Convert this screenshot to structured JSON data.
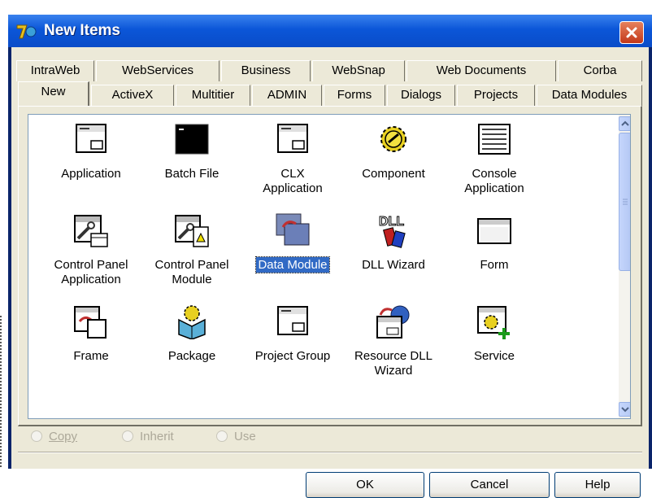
{
  "window": {
    "title": "New Items"
  },
  "tabs_row1": [
    "IntraWeb",
    "WebServices",
    "Business",
    "WebSnap",
    "Web Documents",
    "Corba"
  ],
  "tabs_row2": [
    "New",
    "ActiveX",
    "Multitier",
    "ADMIN",
    "Forms",
    "Dialogs",
    "Projects",
    "Data Modules"
  ],
  "selected_tab": "New",
  "items": [
    {
      "line1": "Application",
      "line2": "",
      "icon": "application-window-icon"
    },
    {
      "line1": "Batch File",
      "line2": "",
      "icon": "batch-file-icon"
    },
    {
      "line1": "CLX",
      "line2": "Application",
      "icon": "clx-application-icon"
    },
    {
      "line1": "Component",
      "line2": "",
      "icon": "component-gear-icon"
    },
    {
      "line1": "Console",
      "line2": "Application",
      "icon": "console-application-icon"
    },
    {
      "line1": "Control Panel",
      "line2": "Application",
      "icon": "control-panel-application-icon"
    },
    {
      "line1": "Control Panel",
      "line2": "Module",
      "icon": "control-panel-module-icon"
    },
    {
      "line1": "Data Module",
      "line2": "",
      "icon": "data-module-icon"
    },
    {
      "line1": "DLL Wizard",
      "line2": "",
      "icon": "dll-wizard-icon"
    },
    {
      "line1": "Form",
      "line2": "",
      "icon": "form-icon"
    },
    {
      "line1": "Frame",
      "line2": "",
      "icon": "frame-icon"
    },
    {
      "line1": "Package",
      "line2": "",
      "icon": "package-icon"
    },
    {
      "line1": "Project Group",
      "line2": "",
      "icon": "project-group-icon"
    },
    {
      "line1": "Resource DLL",
      "line2": "Wizard",
      "icon": "resource-dll-wizard-icon"
    },
    {
      "line1": "Service",
      "line2": "",
      "icon": "service-icon"
    }
  ],
  "selected_item": "Data Module",
  "options": [
    {
      "label": "Copy",
      "key": "C"
    },
    {
      "label": "Inherit",
      "key": "I"
    },
    {
      "label": "Use",
      "key": "U"
    }
  ],
  "buttons": {
    "ok": "OK",
    "cancel": "Cancel",
    "help": "Help"
  },
  "colors": {
    "titlebar": "#0b56d8",
    "selection": "#316ac5",
    "dialog_face": "#ece9d8",
    "close": "#c3381a"
  }
}
